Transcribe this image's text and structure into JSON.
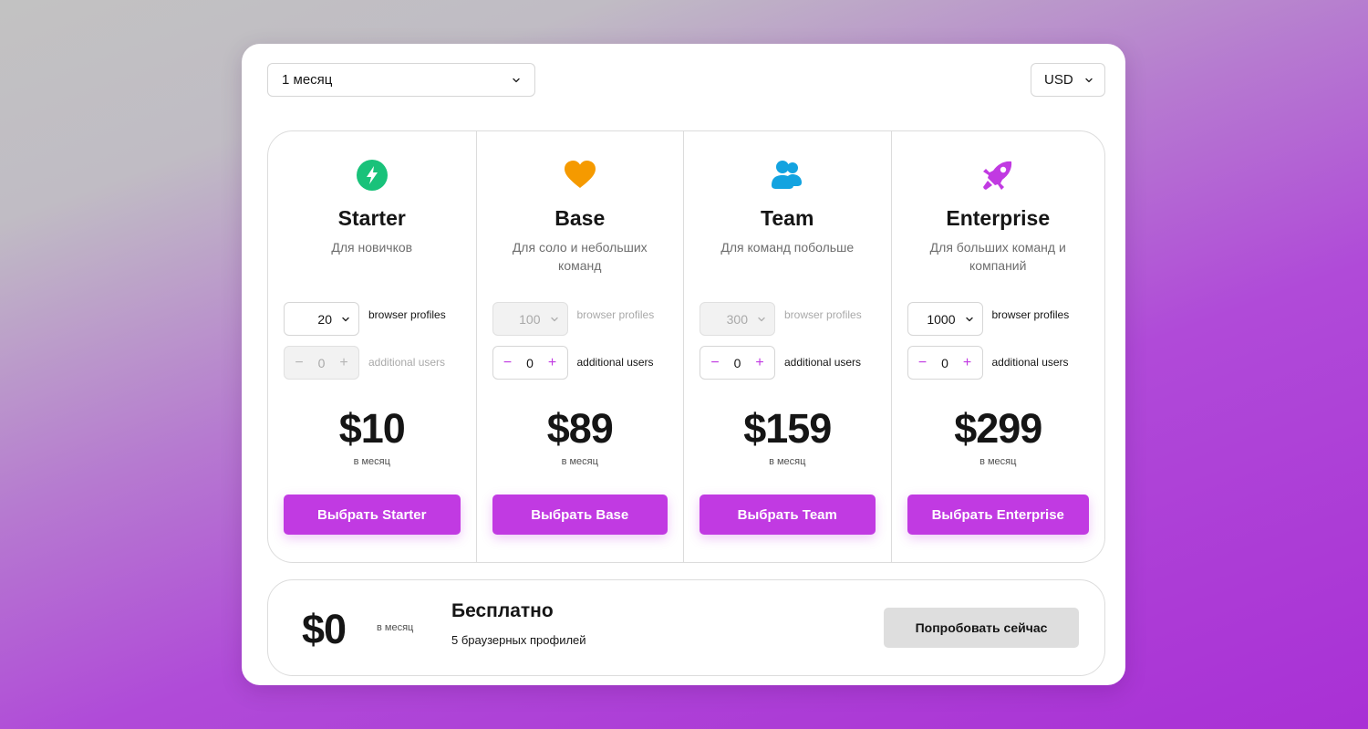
{
  "period_select": {
    "value": "1 месяц"
  },
  "currency_select": {
    "value": "USD"
  },
  "plans": [
    {
      "name": "Starter",
      "icon": "lightning-icon",
      "icon_color": "#19c27a",
      "description": "Для новичков",
      "profiles": {
        "value": "20",
        "label": "browser profiles",
        "disabled": false
      },
      "users": {
        "value": "0",
        "label": "additional users",
        "disabled": true,
        "minus": "−",
        "plus": "+"
      },
      "price": "$10",
      "per": "в месяц",
      "button": "Выбрать Starter"
    },
    {
      "name": "Base",
      "icon": "heart-icon",
      "icon_color": "#f59a00",
      "description": "Для соло и небольших команд",
      "profiles": {
        "value": "100",
        "label": "browser profiles",
        "disabled": true
      },
      "users": {
        "value": "0",
        "label": "additional users",
        "disabled": false,
        "minus": "−",
        "plus": "+"
      },
      "price": "$89",
      "per": "в месяц",
      "button": "Выбрать Base"
    },
    {
      "name": "Team",
      "icon": "users-icon",
      "icon_color": "#13a3e0",
      "description": "Для команд побольше",
      "profiles": {
        "value": "300",
        "label": "browser profiles",
        "disabled": true
      },
      "users": {
        "value": "0",
        "label": "additional users",
        "disabled": false,
        "minus": "−",
        "plus": "+"
      },
      "price": "$159",
      "per": "в месяц",
      "button": "Выбрать Team"
    },
    {
      "name": "Enterprise",
      "icon": "rocket-icon",
      "icon_color": "#c13ae2",
      "description": "Для больших команд и компаний",
      "profiles": {
        "value": "1000",
        "label": "browser profiles",
        "disabled": false
      },
      "users": {
        "value": "0",
        "label": "additional users",
        "disabled": false,
        "minus": "−",
        "plus": "+"
      },
      "price": "$299",
      "per": "в месяц",
      "button": "Выбрать Enterprise"
    }
  ],
  "free_plan": {
    "price": "$0",
    "per": "в месяц",
    "title": "Бесплатно",
    "subtitle": "5 браузерных профилей",
    "button": "Попробовать сейчас"
  },
  "colors": {
    "accent": "#c13ae2",
    "secondary_button": "#dedede",
    "border": "#dcdcdc"
  }
}
